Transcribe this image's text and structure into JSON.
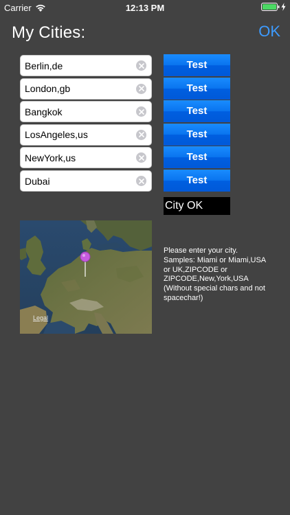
{
  "status_bar": {
    "carrier": "Carrier",
    "time": "12:13 PM",
    "wifi_icon": "wifi-icon",
    "battery_icon": "battery-icon",
    "battery_color": "#4cd964"
  },
  "nav": {
    "title": "My Cities:",
    "ok_label": "OK",
    "ok_color": "#3d9bff"
  },
  "cities": [
    {
      "value": "Berlin,de",
      "button_label": "Test"
    },
    {
      "value": "London,gb",
      "button_label": "Test"
    },
    {
      "value": "Bangkok",
      "button_label": "Test"
    },
    {
      "value": "LosAngeles,us",
      "button_label": "Test"
    },
    {
      "value": "NewYork,us",
      "button_label": "Test"
    },
    {
      "value": "Dubai",
      "button_label": "Test"
    }
  ],
  "city_status": "City OK",
  "map": {
    "legal_label": "Legal",
    "pin_color": "#c75bdf"
  },
  "help_text": "Please enter your city.\nSamples: Miami or Miami,USA or UK,ZIPCODE or ZIPCODE,New,York,USA\n(Without special chars and not spacechar!)"
}
